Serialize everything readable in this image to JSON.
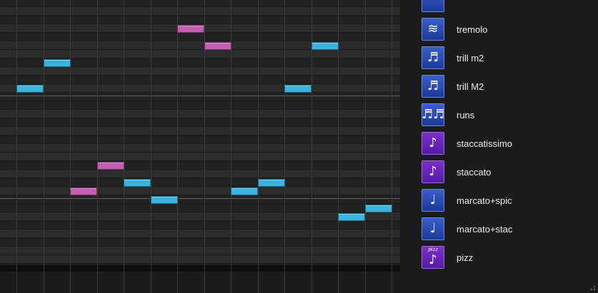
{
  "piano_roll": {
    "notes": [
      {
        "color": "blue",
        "beat": 0,
        "length": 1,
        "row": 10
      },
      {
        "color": "blue",
        "beat": 1,
        "length": 1,
        "row": 7
      },
      {
        "color": "pink",
        "beat": 2,
        "length": 1,
        "row": 22
      },
      {
        "color": "pink",
        "beat": 3,
        "length": 1,
        "row": 19
      },
      {
        "color": "blue",
        "beat": 4,
        "length": 1,
        "row": 21
      },
      {
        "color": "blue",
        "beat": 5,
        "length": 1,
        "row": 23
      },
      {
        "color": "pink",
        "beat": 6,
        "length": 1,
        "row": 3
      },
      {
        "color": "pink",
        "beat": 7,
        "length": 1,
        "row": 5
      },
      {
        "color": "blue",
        "beat": 8,
        "length": 1,
        "row": 22
      },
      {
        "color": "blue",
        "beat": 9,
        "length": 1,
        "row": 21
      },
      {
        "color": "blue",
        "beat": 10,
        "length": 1,
        "row": 10
      },
      {
        "color": "blue",
        "beat": 11,
        "length": 1,
        "row": 5
      },
      {
        "color": "blue",
        "beat": 12,
        "length": 1,
        "row": 25
      },
      {
        "color": "blue",
        "beat": 13,
        "length": 1,
        "row": 24
      }
    ],
    "colors": {
      "blue": "#3db4e0",
      "pink": "#c45eb0"
    }
  },
  "articulations": [
    {
      "label": "",
      "icon": "partial-icon",
      "color": "blue",
      "glyph": ""
    },
    {
      "label": "tremolo",
      "icon": "tremolo-icon",
      "color": "blue",
      "glyph": "≋"
    },
    {
      "label": "trill m2",
      "icon": "trill-m2-icon",
      "color": "blue",
      "glyph": "♬"
    },
    {
      "label": "trill M2",
      "icon": "trill-M2-icon",
      "color": "blue",
      "glyph": "♬"
    },
    {
      "label": "runs",
      "icon": "runs-icon",
      "color": "blue",
      "glyph": "♬♬"
    },
    {
      "label": "staccatissimo",
      "icon": "staccatissimo-icon",
      "color": "purple",
      "glyph": "♪"
    },
    {
      "label": "staccato",
      "icon": "staccato-icon",
      "color": "purple",
      "glyph": "♪"
    },
    {
      "label": "marcato+spic",
      "icon": "marcato-spic-icon",
      "color": "blue",
      "glyph": "♩"
    },
    {
      "label": "marcato+stac",
      "icon": "marcato-stac-icon",
      "color": "blue",
      "glyph": "♩"
    },
    {
      "label": "pizz",
      "icon": "pizz-icon",
      "color": "purple",
      "glyph": "♪",
      "tag": "pizz"
    }
  ]
}
